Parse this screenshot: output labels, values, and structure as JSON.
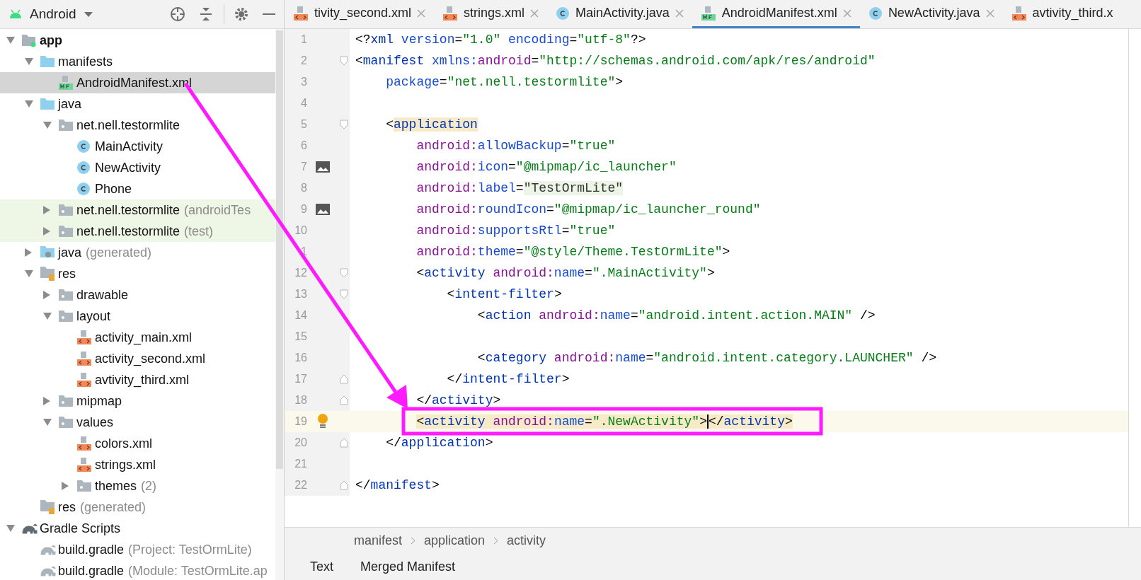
{
  "project_panel": {
    "view_selector": "Android",
    "tree": [
      {
        "label": "app",
        "bold": true,
        "kind": "module",
        "expanded": true,
        "children": [
          {
            "label": "manifests",
            "kind": "folder",
            "expanded": true,
            "children": [
              {
                "label": "AndroidManifest.xml",
                "kind": "manifest",
                "selected": true
              }
            ]
          },
          {
            "label": "java",
            "kind": "folder",
            "expanded": true,
            "children": [
              {
                "label": "net.nell.testormlite",
                "kind": "package",
                "expanded": true,
                "children": [
                  {
                    "label": "MainActivity",
                    "kind": "class",
                    "selected": false
                  },
                  {
                    "label": "NewActivity",
                    "kind": "class",
                    "selected": false
                  },
                  {
                    "label": "Phone",
                    "kind": "class",
                    "selected": false
                  }
                ]
              },
              {
                "label": "net.nell.testormlite",
                "suffix": "(androidTes",
                "kind": "package",
                "expanded": false,
                "tinted": true
              },
              {
                "label": "net.nell.testormlite",
                "suffix": "(test)",
                "kind": "package",
                "expanded": false,
                "tinted": true
              }
            ]
          },
          {
            "label": "java",
            "suffix": "(generated)",
            "kind": "generated",
            "expanded": false
          },
          {
            "label": "res",
            "kind": "res",
            "expanded": true,
            "children": [
              {
                "label": "drawable",
                "kind": "package",
                "expanded": false
              },
              {
                "label": "layout",
                "kind": "package",
                "expanded": true,
                "children": [
                  {
                    "label": "activity_main.xml",
                    "kind": "xml",
                    "selected": false
                  },
                  {
                    "label": "activity_second.xml",
                    "kind": "xml",
                    "selected": false
                  },
                  {
                    "label": "avtivity_third.xml",
                    "kind": "xml",
                    "selected": false
                  }
                ]
              },
              {
                "label": "mipmap",
                "kind": "package",
                "expanded": false
              },
              {
                "label": "values",
                "kind": "package",
                "expanded": true,
                "children": [
                  {
                    "label": "colors.xml",
                    "kind": "xml",
                    "selected": false
                  },
                  {
                    "label": "strings.xml",
                    "kind": "xml",
                    "selected": false
                  },
                  {
                    "label": "themes",
                    "suffix": "(2)",
                    "kind": "package",
                    "expanded": false
                  }
                ]
              }
            ]
          },
          {
            "label": "res",
            "suffix": "(generated)",
            "kind": "res"
          }
        ]
      },
      {
        "label": "Gradle Scripts",
        "bold": false,
        "kind": "gradle",
        "expanded": true,
        "children": [
          {
            "label": "build.gradle",
            "suffix": "(Project: TestOrmLite)",
            "kind": "gradle-file",
            "selected": false
          },
          {
            "label": "build.gradle",
            "suffix": "(Module: TestOrmLite.ap",
            "kind": "gradle-file",
            "selected": false
          }
        ]
      }
    ]
  },
  "editor_tabs": [
    {
      "label": "tivity_second.xml",
      "kind": "xml",
      "selected": false
    },
    {
      "label": "strings.xml",
      "kind": "xml",
      "selected": false
    },
    {
      "label": "MainActivity.java",
      "kind": "class",
      "selected": false
    },
    {
      "label": "AndroidManifest.xml",
      "kind": "manifest",
      "selected": true
    },
    {
      "label": "NewActivity.java",
      "kind": "class",
      "selected": false
    },
    {
      "label": "avtivity_third.x",
      "kind": "xml",
      "selected": false
    }
  ],
  "code_lines": [
    {
      "number": "1",
      "tokens": [
        {
          "kind": "punct",
          "text": "<?"
        },
        {
          "kind": "tag",
          "text": "xml "
        },
        {
          "kind": "attr",
          "text": "version"
        },
        {
          "kind": "punct",
          "text": "="
        },
        {
          "kind": "value",
          "text": "\"1.0\" "
        },
        {
          "kind": "attr",
          "text": "encoding"
        },
        {
          "kind": "punct",
          "text": "="
        },
        {
          "kind": "value",
          "text": "\"utf-8\""
        },
        {
          "kind": "punct",
          "text": "?>"
        }
      ]
    },
    {
      "number": "2",
      "fold_start": true,
      "tokens": [
        {
          "kind": "punct",
          "text": "<"
        },
        {
          "kind": "tag",
          "text": "manifest "
        },
        {
          "kind": "attr",
          "text": "xmlns:"
        },
        {
          "kind": "ns",
          "text": "android"
        },
        {
          "kind": "punct",
          "text": "="
        },
        {
          "kind": "value",
          "text": "\"http://schemas.android.com/apk/res/android\""
        }
      ]
    },
    {
      "number": "3",
      "tokens": [
        {
          "kind": "attr",
          "text": "    package"
        },
        {
          "kind": "punct",
          "text": "="
        },
        {
          "kind": "value",
          "text": "\"net.nell.testormlite\""
        },
        {
          "kind": "punct",
          "text": ">"
        }
      ]
    },
    {
      "number": "4"
    },
    {
      "number": "5",
      "fold_start": true,
      "tokens": [
        {
          "kind": "punct",
          "text": "    <"
        },
        {
          "kind": "tag",
          "text": "application",
          "highlight": true
        }
      ]
    },
    {
      "number": "6",
      "tokens": [
        {
          "kind": "ns",
          "text": "        android:"
        },
        {
          "kind": "attr",
          "text": "allowBackup"
        },
        {
          "kind": "punct",
          "text": "="
        },
        {
          "kind": "value",
          "text": "\"true\""
        }
      ]
    },
    {
      "number": "7",
      "kind": "image",
      "tokens": [
        {
          "kind": "ns",
          "text": "        android:"
        },
        {
          "kind": "attr",
          "text": "icon"
        },
        {
          "kind": "punct",
          "text": "="
        },
        {
          "kind": "value",
          "text": "\"@mipmap/ic_launcher\""
        }
      ]
    },
    {
      "number": "8",
      "tokens": [
        {
          "kind": "ns",
          "text": "        android:"
        },
        {
          "kind": "attr",
          "text": "label"
        },
        {
          "kind": "punct",
          "text": "="
        },
        {
          "kind": "string",
          "text": "\"TestOrmLite\"",
          "highlight": true
        }
      ]
    },
    {
      "number": "9",
      "kind": "image",
      "tokens": [
        {
          "kind": "ns",
          "text": "        android:"
        },
        {
          "kind": "attr",
          "text": "roundIcon"
        },
        {
          "kind": "punct",
          "text": "="
        },
        {
          "kind": "value",
          "text": "\"@mipmap/ic_launcher_round\""
        }
      ]
    },
    {
      "number": "10",
      "tokens": [
        {
          "kind": "ns",
          "text": "        android:"
        },
        {
          "kind": "attr",
          "text": "supportsRtl"
        },
        {
          "kind": "punct",
          "text": "="
        },
        {
          "kind": "value",
          "text": "\"true\""
        }
      ]
    },
    {
      "number": "1",
      "tokens": [
        {
          "kind": "ns",
          "text": "        android:"
        },
        {
          "kind": "attr",
          "text": "theme"
        },
        {
          "kind": "punct",
          "text": "="
        },
        {
          "kind": "value",
          "text": "\"@style/Theme.TestOrmLite\""
        },
        {
          "kind": "punct",
          "text": ">"
        }
      ]
    },
    {
      "number": "12",
      "fold_start": true,
      "tokens": [
        {
          "kind": "punct",
          "text": "        <"
        },
        {
          "kind": "tag",
          "text": "activity "
        },
        {
          "kind": "ns",
          "text": "android:"
        },
        {
          "kind": "attr",
          "text": "name"
        },
        {
          "kind": "punct",
          "text": "="
        },
        {
          "kind": "value",
          "text": "\".MainActivity\""
        },
        {
          "kind": "punct",
          "text": ">"
        }
      ]
    },
    {
      "number": "13",
      "fold_start": true,
      "tokens": [
        {
          "kind": "punct",
          "text": "            <"
        },
        {
          "kind": "tag",
          "text": "intent-filter"
        },
        {
          "kind": "punct",
          "text": ">"
        }
      ]
    },
    {
      "number": "14",
      "tokens": [
        {
          "kind": "punct",
          "text": "                <"
        },
        {
          "kind": "tag",
          "text": "action "
        },
        {
          "kind": "ns",
          "text": "android:"
        },
        {
          "kind": "attr",
          "text": "name"
        },
        {
          "kind": "punct",
          "text": "="
        },
        {
          "kind": "value",
          "text": "\"android.intent.action.MAIN\""
        },
        {
          "kind": "punct",
          "text": " />"
        }
      ]
    },
    {
      "number": "15"
    },
    {
      "number": "16",
      "tokens": [
        {
          "kind": "punct",
          "text": "                <"
        },
        {
          "kind": "tag",
          "text": "category "
        },
        {
          "kind": "ns",
          "text": "android:"
        },
        {
          "kind": "attr",
          "text": "name"
        },
        {
          "kind": "punct",
          "text": "="
        },
        {
          "kind": "value",
          "text": "\"android.intent.category.LAUNCHER\""
        },
        {
          "kind": "punct",
          "text": " />"
        }
      ]
    },
    {
      "number": "17",
      "fold_end": true,
      "tokens": [
        {
          "kind": "punct",
          "text": "            </"
        },
        {
          "kind": "tag",
          "text": "intent-filter"
        },
        {
          "kind": "punct",
          "text": ">"
        }
      ]
    },
    {
      "number": "18",
      "fold_end": true,
      "tokens": [
        {
          "kind": "punct",
          "text": "        </"
        },
        {
          "kind": "tag",
          "text": "activity"
        },
        {
          "kind": "punct",
          "text": ">"
        }
      ]
    },
    {
      "number": "19",
      "current": true,
      "kind": "bulb",
      "tokens": [
        {
          "kind": "punct",
          "text": "        <",
          "highlight": true
        },
        {
          "kind": "tag",
          "text": "activity ",
          "highlight": true
        },
        {
          "kind": "ns",
          "text": "android:",
          "highlight": true
        },
        {
          "kind": "attr",
          "text": "name",
          "highlight": true
        },
        {
          "kind": "punct",
          "text": "=",
          "highlight": true
        },
        {
          "kind": "value",
          "text": "\".NewActivity\"",
          "highlight": true
        },
        {
          "kind": "punct",
          "text": ">",
          "highlight": true
        },
        {
          "kind": "caret"
        },
        {
          "kind": "punct",
          "text": "</",
          "highlight": true
        },
        {
          "kind": "tag",
          "text": "activity",
          "highlight": true
        },
        {
          "kind": "punct",
          "text": ">",
          "highlight": true
        }
      ]
    },
    {
      "number": "20",
      "fold_end": true,
      "tokens": [
        {
          "kind": "punct",
          "text": "    </"
        },
        {
          "kind": "tag",
          "text": "application"
        },
        {
          "kind": "punct",
          "text": ">"
        }
      ]
    },
    {
      "number": "21"
    },
    {
      "number": "22",
      "fold_end": true,
      "tokens": [
        {
          "kind": "punct",
          "text": "</"
        },
        {
          "kind": "tag",
          "text": "manifest"
        },
        {
          "kind": "punct",
          "text": ">"
        }
      ]
    }
  ],
  "breadcrumb": [
    "manifest",
    "application",
    "activity"
  ],
  "bottom_tabs": [
    "Text",
    "Merged Manifest"
  ]
}
